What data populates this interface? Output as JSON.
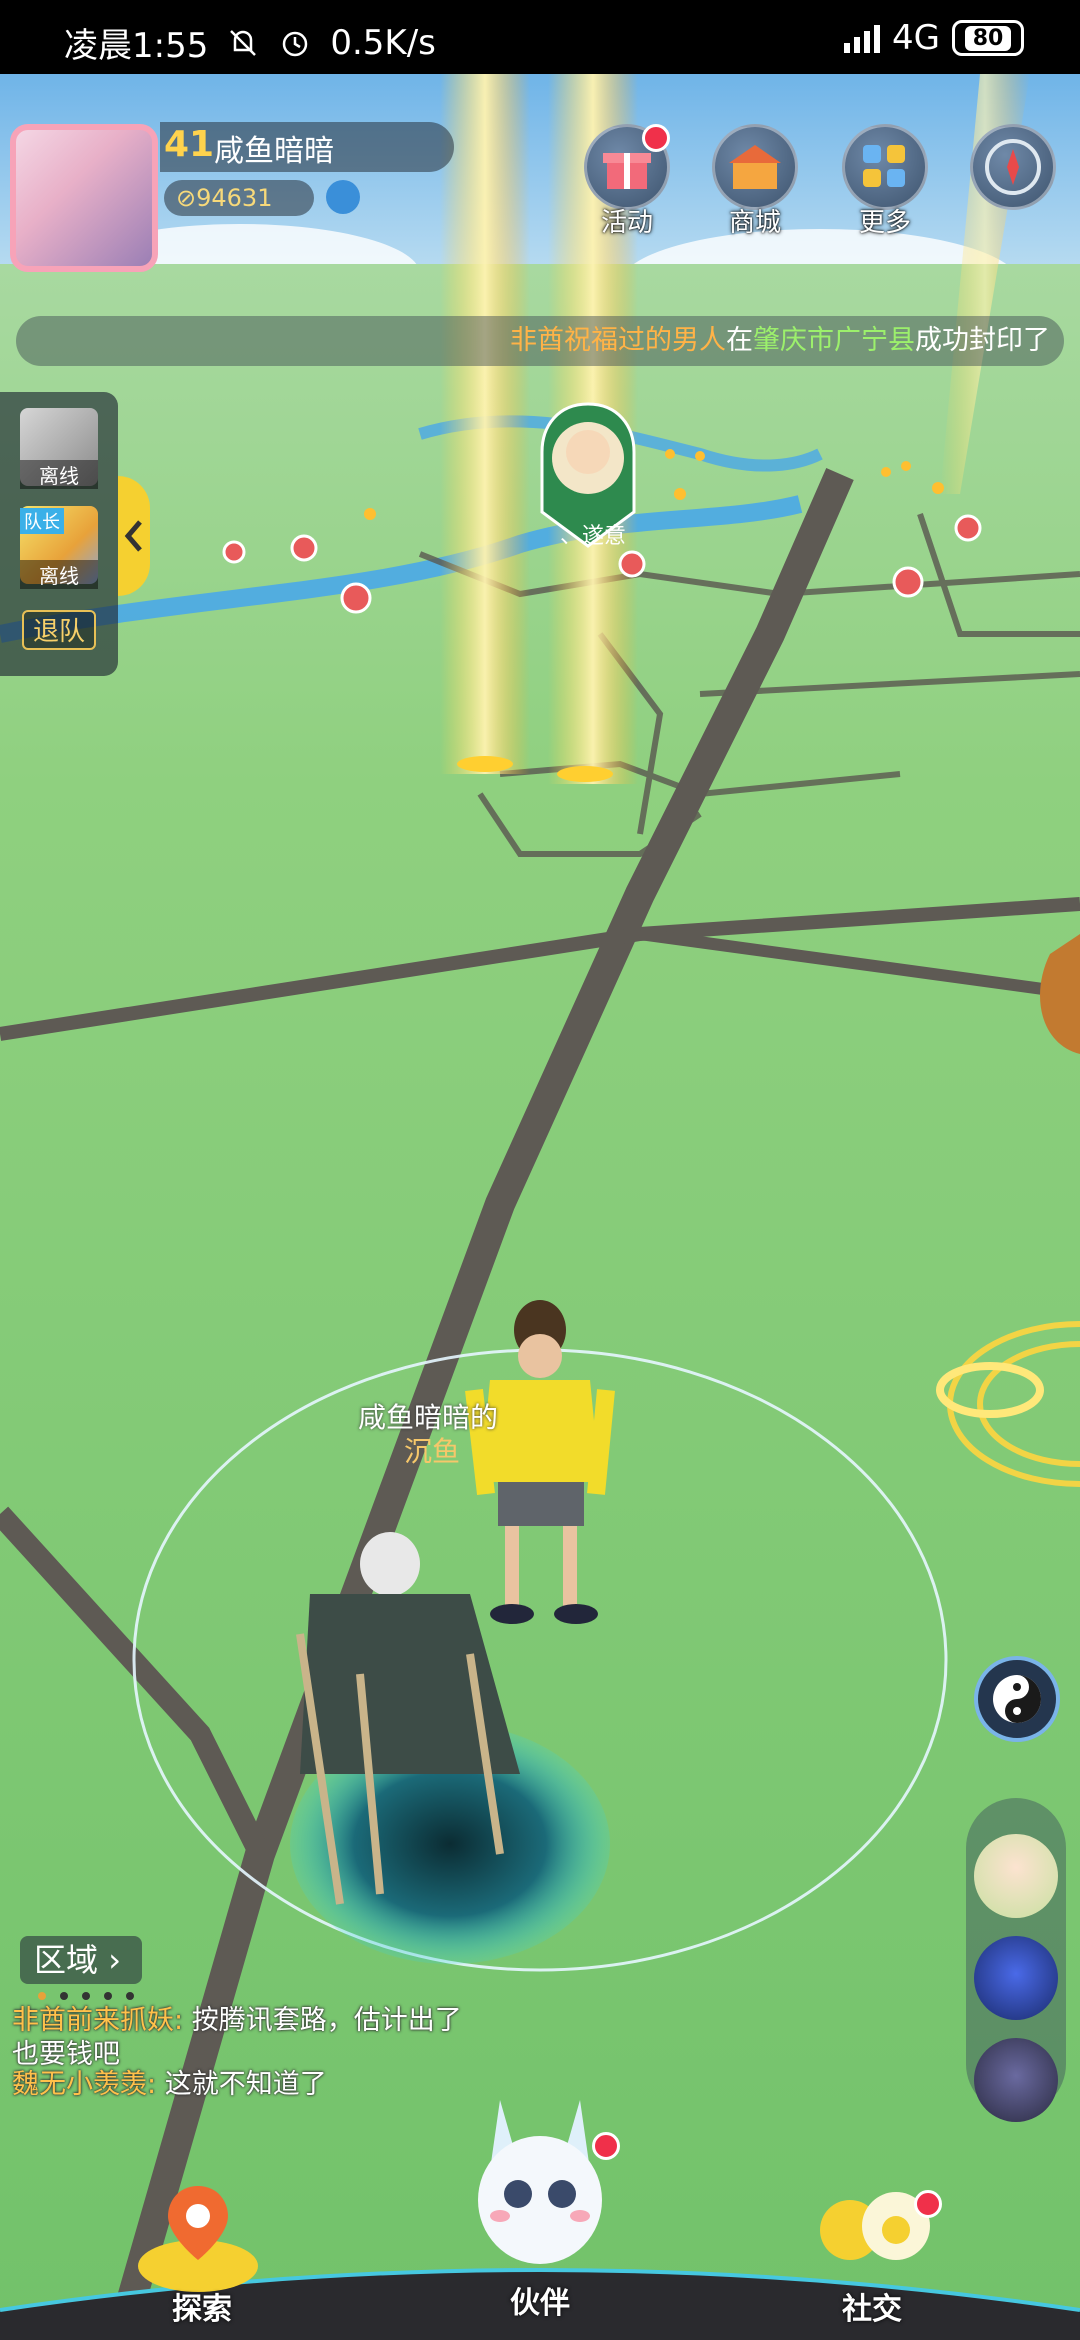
{
  "status_bar": {
    "time": "凌晨1:55",
    "speed": "0.5K/s",
    "network": "4G",
    "battery": "80"
  },
  "player": {
    "level": "41",
    "name": "咸鱼暗暗",
    "coins": "94631"
  },
  "top_buttons": [
    {
      "label": "活动",
      "icon": "gift-icon",
      "badge": true
    },
    {
      "label": "商城",
      "icon": "shop-icon",
      "badge": false
    },
    {
      "label": "更多",
      "icon": "more-icon",
      "badge": false
    }
  ],
  "ticker": {
    "player": "非酋祝福过的男人",
    "word1": "在",
    "place": "肇庆市广宁县",
    "word2": "成功封印了"
  },
  "team": {
    "members": [
      {
        "status": "离线",
        "captain": false
      },
      {
        "status": "离线",
        "captain": true,
        "captain_label": "队长"
      }
    ],
    "quit_label": "退队"
  },
  "npc_label": "、遂意",
  "pet_label": {
    "owner": "咸鱼暗暗的",
    "name": "沉鱼"
  },
  "region_label": "区域",
  "chat": [
    {
      "name": "非酋前来抓妖:",
      "text": " 按腾讯套路，估计出了也要钱吧"
    },
    {
      "name": "魏无小羡羡:",
      "text": " 这就不知道了"
    }
  ],
  "nav": {
    "explore": "探索",
    "partner": "伙伴",
    "social": "社交"
  },
  "colors": {
    "map_grass": "#7fc97a",
    "road": "#5a5750",
    "river": "#4aa8e8",
    "accent_gold": "#f5d030"
  }
}
